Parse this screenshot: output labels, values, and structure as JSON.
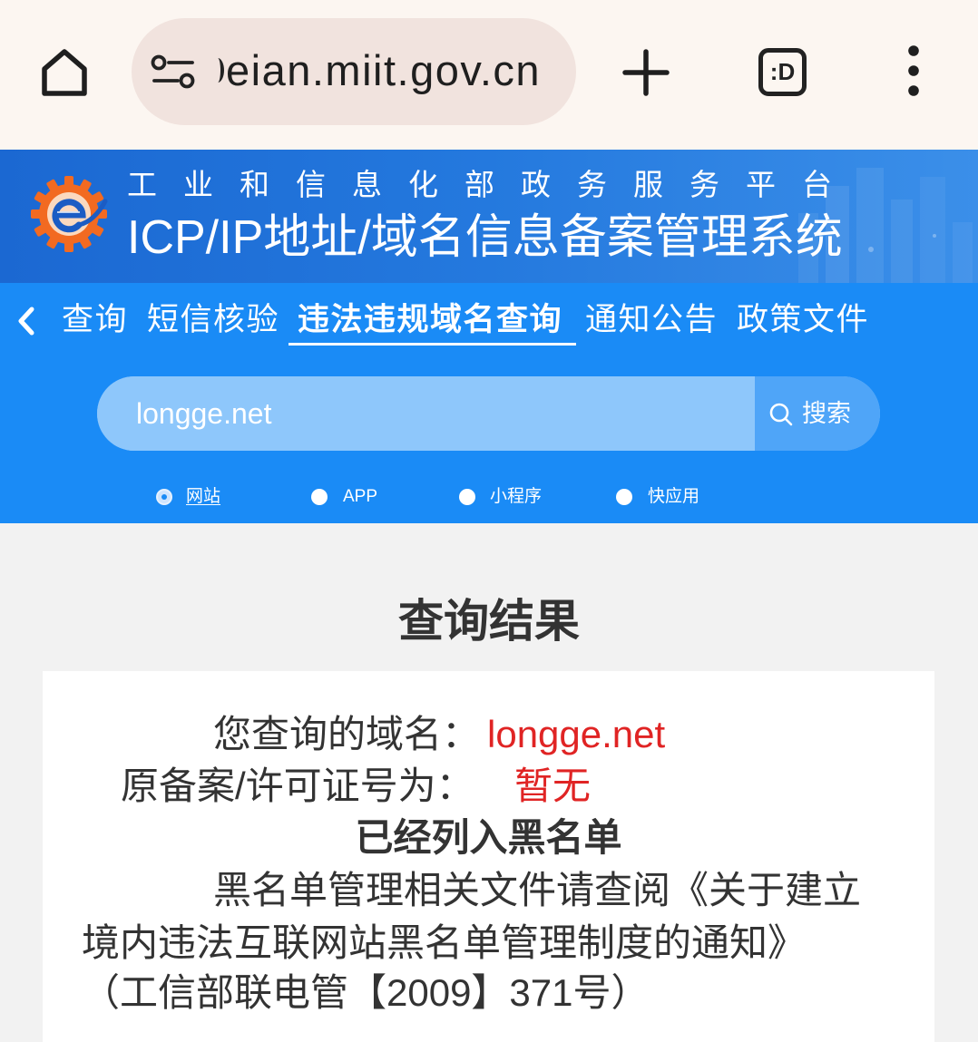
{
  "browser": {
    "url": "eian.miit.gov.cn",
    "tab_switcher_label": ":D",
    "icons": [
      "home-icon",
      "site-settings-icon",
      "new-tab-plus-icon",
      "tab-switcher-icon",
      "more-vert-icon"
    ]
  },
  "banner": {
    "subtitle": "工业和信息化部政务服务平台",
    "title": "ICP/IP地址/域名信息备案管理系统",
    "logo_icon": "gear-e-logo-icon"
  },
  "nav": {
    "scroll_icon": "chevron-left-icon",
    "items": [
      {
        "label": "查询",
        "active": false
      },
      {
        "label": "短信核验",
        "active": false
      },
      {
        "label": "违法违规域名查询",
        "active": true
      },
      {
        "label": "通知公告",
        "active": false
      },
      {
        "label": "政策文件",
        "active": false
      }
    ]
  },
  "search": {
    "value": "longge.net",
    "button_label": "搜索",
    "button_icon": "search-icon",
    "types": [
      {
        "label": "网站",
        "selected": true
      },
      {
        "label": "APP",
        "selected": false
      },
      {
        "label": "小程序",
        "selected": false
      },
      {
        "label": "快应用",
        "selected": false
      }
    ]
  },
  "result": {
    "heading": "查询结果",
    "domain_label": "您查询的域名：",
    "domain_value": "longge.net",
    "license_label": "原备案/许可证号为：",
    "license_value": "暂无",
    "status": "已经列入黑名单",
    "notice_lines": [
      "黑名单管理相关文件请查阅《关于建立",
      "境内违法互联网站黑名单管理制度的通知》",
      "（工信部联电管【2009】371号）"
    ]
  },
  "colors": {
    "browser_bar": "#fcf6f1",
    "url_pill": "#f1e3de",
    "banner_blue": "#2479de",
    "nav_blue": "#1a8bf6",
    "search_field": "#8ec7fb",
    "search_button": "#4fa5f8",
    "highlight_red": "#e02424",
    "page_bg": "#f2f2f2",
    "text_dark": "#333333"
  }
}
